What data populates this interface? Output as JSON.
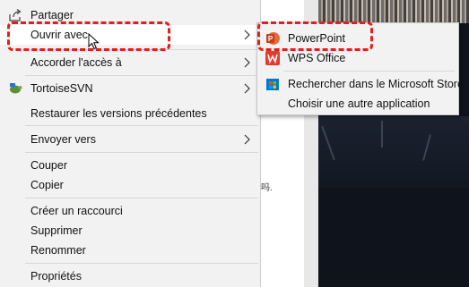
{
  "main_menu": {
    "items": [
      {
        "label": "Partager",
        "icon": "share-icon"
      },
      {
        "label": "Ouvrir avec",
        "icon": "none",
        "submenu": true
      },
      {
        "label": "Accorder l'accès à",
        "icon": "none",
        "submenu": true
      },
      {
        "label": "TortoiseSVN",
        "icon": "tortoisesvn-icon",
        "submenu": true
      },
      {
        "label": "Restaurer les versions précédentes"
      },
      {
        "label": "Envoyer vers",
        "submenu": true
      },
      {
        "label": "Couper"
      },
      {
        "label": "Copier"
      },
      {
        "label": "Créer un raccourci"
      },
      {
        "label": "Supprimer"
      },
      {
        "label": "Renommer"
      },
      {
        "label": "Propriétés"
      }
    ]
  },
  "submenu": {
    "items": [
      {
        "label": "PowerPoint",
        "icon": "powerpoint-icon",
        "color": "#c43e1c"
      },
      {
        "label": "WPS Office",
        "icon": "wps-office-icon",
        "color": "#e33b2e"
      },
      {
        "label": "Rechercher dans le Microsoft Store",
        "icon": "store-icon",
        "color": "#0078d4"
      },
      {
        "label": "Choisir une autre application",
        "icon": "none"
      }
    ]
  },
  "document_fragment": "吗.",
  "colors": {
    "menu_bg": "#f2f2f2",
    "highlight": "#e0201b",
    "hover_bg": "#ffffff"
  }
}
